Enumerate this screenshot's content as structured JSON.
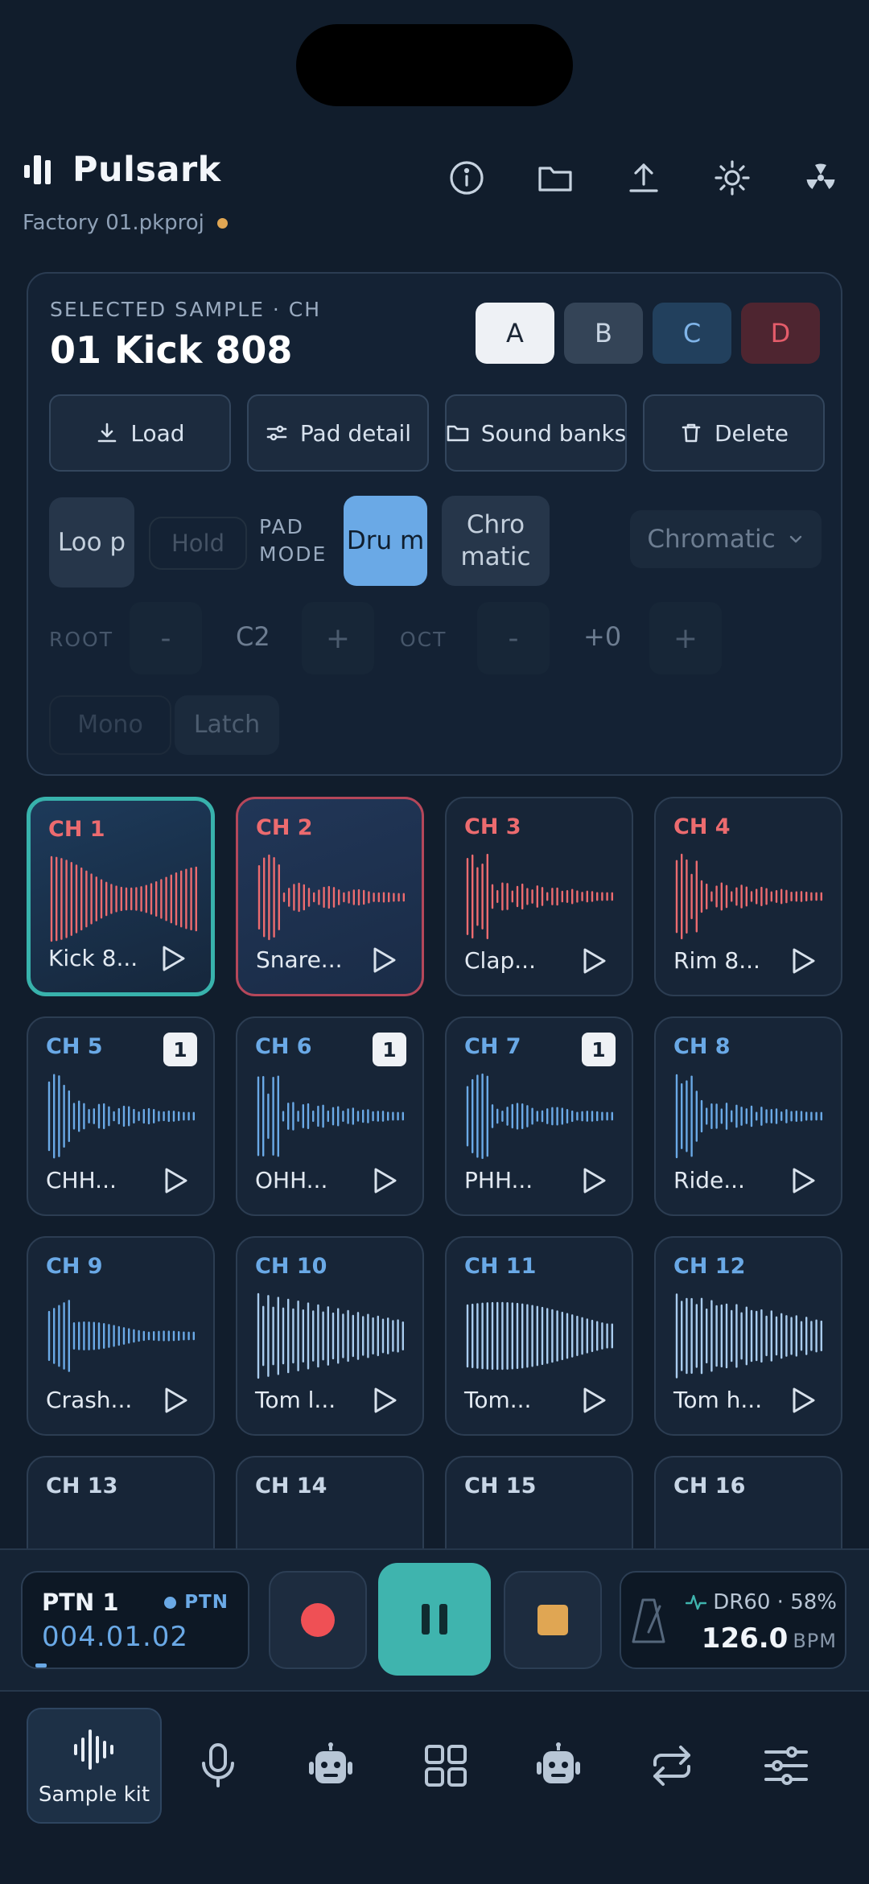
{
  "app": {
    "name": "Pulsark",
    "project_file": "Factory 01.pkproj"
  },
  "header_icons": [
    "info-icon",
    "folder-icon",
    "upload-icon",
    "gear-icon",
    "radiation-icon"
  ],
  "selected": {
    "label": "SELECTED SAMPLE · CH",
    "name": "01 Kick 808",
    "banks": [
      "A",
      "B",
      "C",
      "D"
    ],
    "active_bank": "A"
  },
  "actions": {
    "load": "Load",
    "pad_detail": "Pad detail",
    "sound_banks": "Sound banks",
    "delete": "Delete"
  },
  "modes": {
    "loop": "Loo p",
    "hold": "Hold",
    "pad_mode_label": "PAD MODE",
    "drum": "Dru m",
    "chromatic": "Chro matic",
    "scale_select": "Chromatic"
  },
  "root_row": {
    "root_label": "ROOT",
    "root_value": "C2",
    "oct_label": "OCT",
    "oct_value": "+0",
    "minus": "-",
    "plus": "+"
  },
  "extra": {
    "mono": "Mono",
    "latch": "Latch"
  },
  "pads": [
    {
      "ch": "CH 1",
      "name": "Kick 8..."
    },
    {
      "ch": "CH 2",
      "name": "Snare..."
    },
    {
      "ch": "CH 3",
      "name": "Clap..."
    },
    {
      "ch": "CH 4",
      "name": "Rim 8..."
    },
    {
      "ch": "CH 5",
      "name": "CHH...",
      "badge": "1"
    },
    {
      "ch": "CH 6",
      "name": "OHH...",
      "badge": "1"
    },
    {
      "ch": "CH 7",
      "name": "PHH...",
      "badge": "1"
    },
    {
      "ch": "CH 8",
      "name": "Ride..."
    },
    {
      "ch": "CH 9",
      "name": "Crash..."
    },
    {
      "ch": "CH 10",
      "name": "Tom l..."
    },
    {
      "ch": "CH 11",
      "name": "Tom..."
    },
    {
      "ch": "CH 12",
      "name": "Tom h..."
    },
    {
      "ch": "CH 13",
      "name": ""
    },
    {
      "ch": "CH 14",
      "name": ""
    },
    {
      "ch": "CH 15",
      "name": ""
    },
    {
      "ch": "CH 16",
      "name": ""
    }
  ],
  "transport": {
    "pattern": "PTN 1",
    "mode_tag": "PTN",
    "position": "004.01.02",
    "machine": "DR60 · 58%",
    "tempo": "126.0",
    "tempo_unit": "BPM"
  },
  "nav": {
    "active_label": "Sample kit"
  },
  "colors": {
    "accent": "#3fb4ae",
    "blue": "#6aa9e6",
    "red": "#ec6b6f",
    "orange": "#e0a653",
    "record": "#ef5055"
  }
}
